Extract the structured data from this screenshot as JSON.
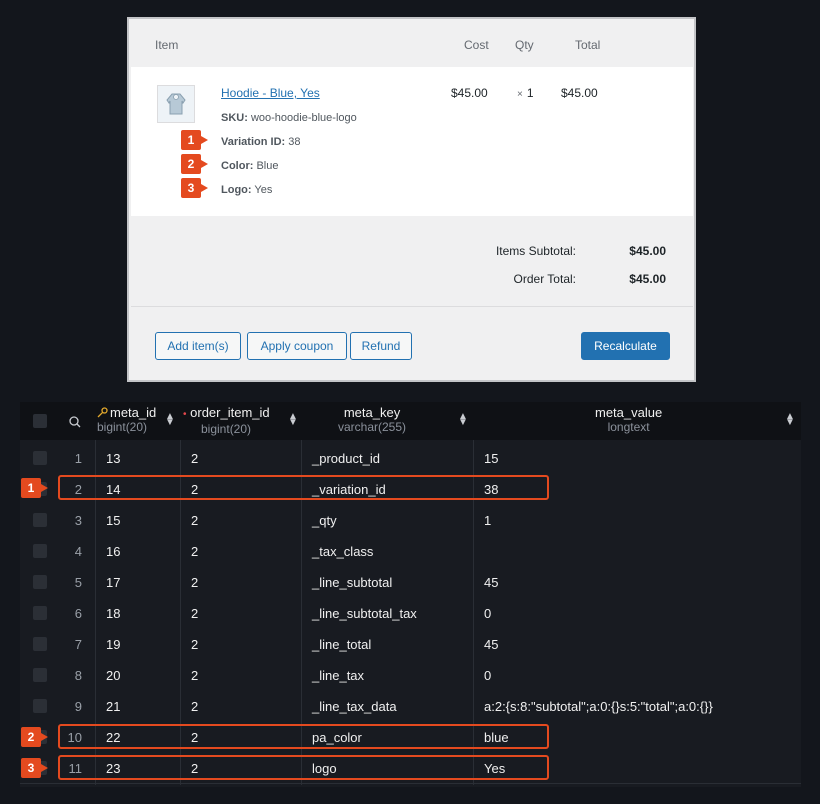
{
  "order": {
    "headers": {
      "item": "Item",
      "cost": "Cost",
      "qty": "Qty",
      "total": "Total"
    },
    "item": {
      "name": "Hoodie - Blue, Yes",
      "sku_label": "SKU:",
      "sku": "woo-hoodie-blue-logo",
      "variation_label": "Variation ID:",
      "variation_id": "38",
      "color_label": "Color:",
      "color": "Blue",
      "logo_label": "Logo:",
      "logo": "Yes",
      "cost": "$45.00",
      "qty_x": "×",
      "qty": "1",
      "total": "$45.00"
    },
    "totals": {
      "subtotal_label": "Items Subtotal:",
      "subtotal": "$45.00",
      "order_total_label": "Order Total:",
      "order_total": "$45.00"
    },
    "buttons": {
      "add_items": "Add item(s)",
      "apply_coupon": "Apply coupon",
      "refund": "Refund",
      "recalculate": "Recalculate"
    }
  },
  "table": {
    "columns": [
      {
        "name": "meta_id",
        "type": "bigint(20)"
      },
      {
        "name": "order_item_id",
        "type": "bigint(20)"
      },
      {
        "name": "meta_key",
        "type": "varchar(255)"
      },
      {
        "name": "meta_value",
        "type": "longtext"
      }
    ],
    "rows": [
      {
        "n": "1",
        "meta_id": "13",
        "order_item_id": "2",
        "meta_key": "_product_id",
        "meta_value": "15"
      },
      {
        "n": "2",
        "meta_id": "14",
        "order_item_id": "2",
        "meta_key": "_variation_id",
        "meta_value": "38"
      },
      {
        "n": "3",
        "meta_id": "15",
        "order_item_id": "2",
        "meta_key": "_qty",
        "meta_value": "1"
      },
      {
        "n": "4",
        "meta_id": "16",
        "order_item_id": "2",
        "meta_key": "_tax_class",
        "meta_value": ""
      },
      {
        "n": "5",
        "meta_id": "17",
        "order_item_id": "2",
        "meta_key": "_line_subtotal",
        "meta_value": "45"
      },
      {
        "n": "6",
        "meta_id": "18",
        "order_item_id": "2",
        "meta_key": "_line_subtotal_tax",
        "meta_value": "0"
      },
      {
        "n": "7",
        "meta_id": "19",
        "order_item_id": "2",
        "meta_key": "_line_total",
        "meta_value": "45"
      },
      {
        "n": "8",
        "meta_id": "20",
        "order_item_id": "2",
        "meta_key": "_line_tax",
        "meta_value": "0"
      },
      {
        "n": "9",
        "meta_id": "21",
        "order_item_id": "2",
        "meta_key": "_line_tax_data",
        "meta_value": "a:2:{s:8:\"subtotal\";a:0:{}s:5:\"total\";a:0:{}}"
      },
      {
        "n": "10",
        "meta_id": "22",
        "order_item_id": "2",
        "meta_key": "pa_color",
        "meta_value": "blue"
      },
      {
        "n": "11",
        "meta_id": "23",
        "order_item_id": "2",
        "meta_key": "logo",
        "meta_value": "Yes"
      }
    ]
  },
  "annotations": {
    "badges": [
      "1",
      "2",
      "3"
    ],
    "accent": "#e44a1f"
  }
}
